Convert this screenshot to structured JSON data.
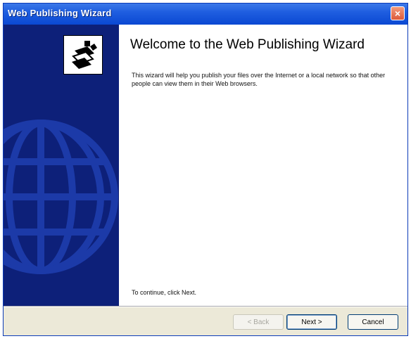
{
  "window": {
    "title": "Web Publishing Wizard",
    "close_glyph": "×"
  },
  "content": {
    "heading": "Welcome to the Web Publishing Wizard",
    "description": "This wizard will help you publish your files over the Internet or a local network so that other people can view them in their Web browsers.",
    "continue_text": "To continue, click Next."
  },
  "buttons": {
    "back": "< Back",
    "next": "Next >",
    "cancel": "Cancel"
  },
  "icons": {
    "wizard": "web-publishing-icon",
    "globe": "globe-graphic"
  },
  "colors": {
    "sidebar": "#0d2079",
    "titlebar": "#1f5ee0",
    "close": "#dd5a3a"
  }
}
